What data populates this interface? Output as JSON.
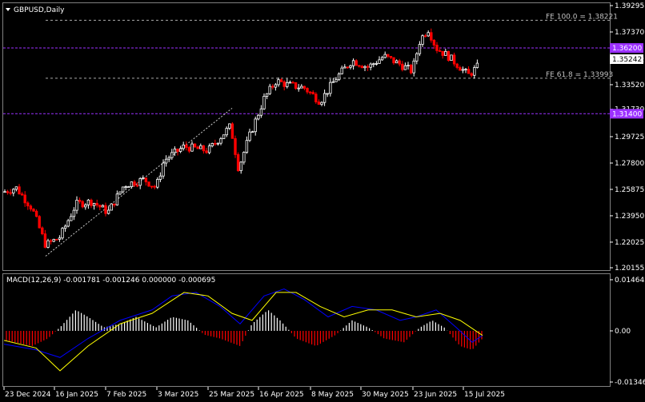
{
  "chart_title": "GBPUSD,Daily",
  "price_axis": {
    "ticks": [
      "1.39295",
      "1.37370",
      "1.35352",
      "1.33520",
      "1.31730",
      "1.29725",
      "1.27800",
      "1.25875",
      "1.23950",
      "1.22025",
      "1.20155"
    ],
    "levels": [
      {
        "label": "1.36200",
        "value": 1.362,
        "color": "#9b30ff"
      },
      {
        "label": "1.31400",
        "value": 1.314,
        "color": "#9b30ff"
      }
    ],
    "current_price": "1.35242"
  },
  "fibo": [
    {
      "label": "FE 100.0 = 1.38221",
      "value": 1.38221
    },
    {
      "label": "FE 61.8 = 1.33993",
      "value": 1.33993
    }
  ],
  "macd": {
    "label": "MACD(12,26,9) -0.001781 -0.001246 0.000000 -0.000695",
    "ticks": [
      "0.014642",
      "0.00",
      "-0.013461"
    ]
  },
  "time_axis": [
    "23 Dec 2024",
    "16 Jan 2025",
    "7 Feb 2025",
    "3 Mar 2025",
    "25 Mar 2025",
    "16 Apr 2025",
    "8 May 2025",
    "30 May 2025",
    "23 Jun 2025",
    "15 Jul 2025"
  ],
  "colors": {
    "up": "#ffffff",
    "down": "#ff0000",
    "macd_line": "#0000ff",
    "signal_line": "#ffff00",
    "level": "#9b30ff",
    "grid": "#aaaaaa"
  },
  "chart_data": {
    "type": "candlestick",
    "title": "GBPUSD,Daily",
    "close_path": [
      [
        "23 Dec 2024",
        1.255
      ],
      [
        "16 Jan 2025",
        1.22
      ],
      [
        "7 Feb 2025",
        1.242
      ],
      [
        "3 Mar 2025",
        1.265
      ],
      [
        "25 Mar 2025",
        1.295
      ],
      [
        "16 Apr 2025",
        1.328
      ],
      [
        "8 May 2025",
        1.33
      ],
      [
        "30 May 2025",
        1.35
      ],
      [
        "23 Jun 2025",
        1.37
      ],
      [
        "15 Jul 2025",
        1.343
      ]
    ],
    "ylim": [
      1.20155,
      1.39295
    ]
  }
}
